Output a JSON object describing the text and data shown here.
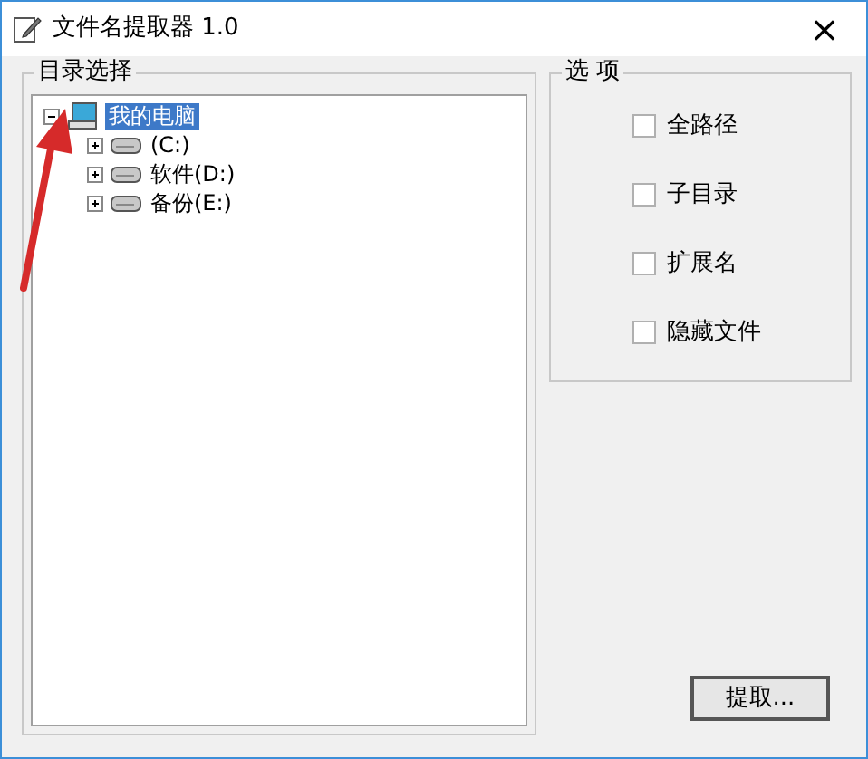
{
  "window": {
    "title": "文件名提取器 1.0",
    "close": "×"
  },
  "directory_group": {
    "title": "目录选择",
    "tree": [
      {
        "label": "我的电脑",
        "kind": "computer",
        "expanded": true,
        "selected": true,
        "children": [
          {
            "label": "(C:)",
            "kind": "drive",
            "expanded": false,
            "selected": false
          },
          {
            "label": "软件(D:)",
            "kind": "drive",
            "expanded": false,
            "selected": false
          },
          {
            "label": "备份(E:)",
            "kind": "drive",
            "expanded": false,
            "selected": false
          }
        ]
      }
    ]
  },
  "options_group": {
    "title": "选 项",
    "options": [
      {
        "label": "全路径",
        "checked": false
      },
      {
        "label": "子目录",
        "checked": false
      },
      {
        "label": "扩展名",
        "checked": false
      },
      {
        "label": "隐藏文件",
        "checked": false
      }
    ]
  },
  "buttons": [
    {
      "label": "提取..."
    }
  ]
}
